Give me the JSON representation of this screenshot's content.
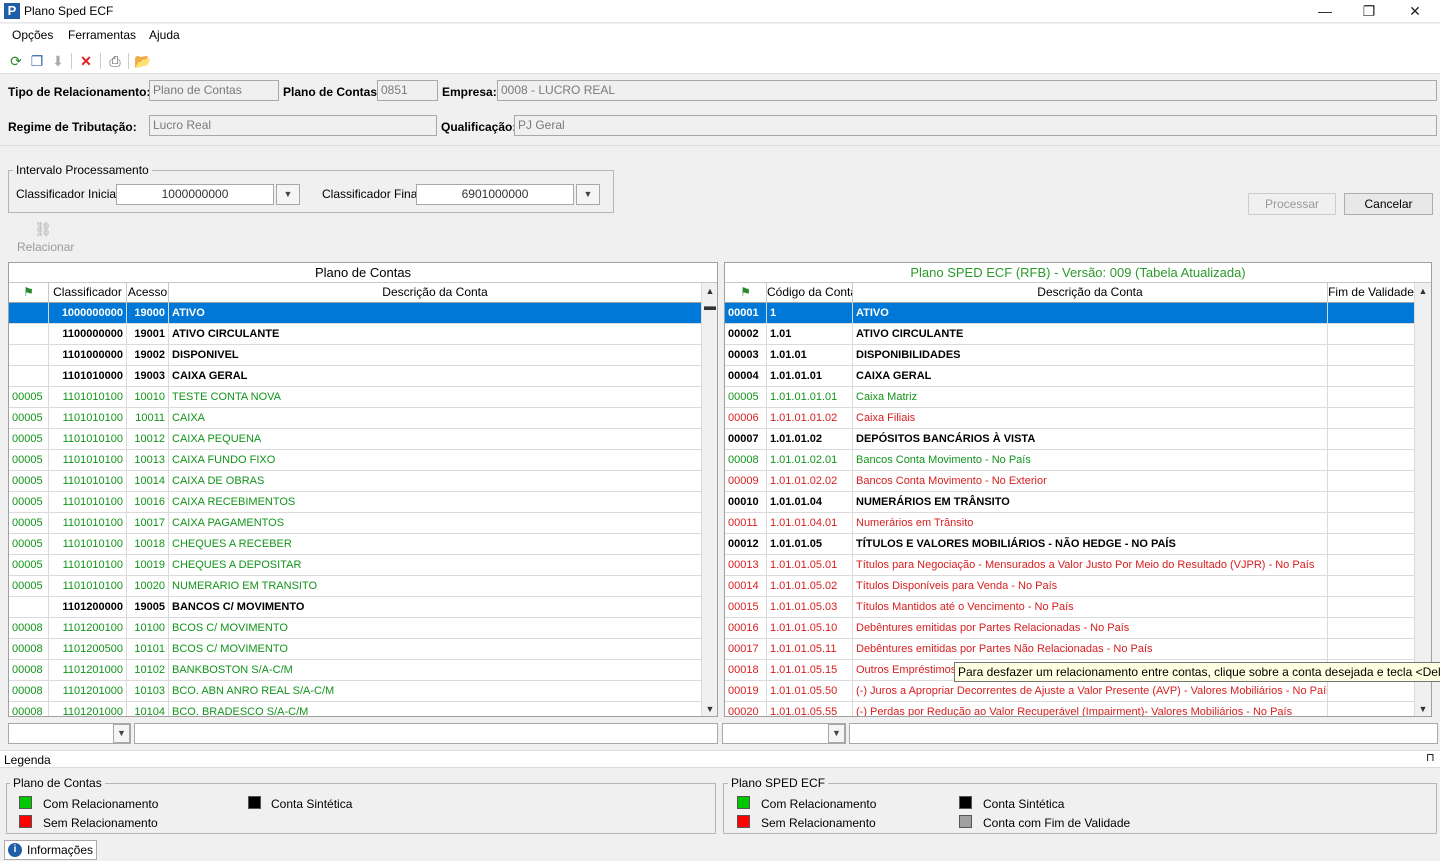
{
  "window": {
    "title": "Plano Sped ECF",
    "minimize": "—",
    "restore": "❐",
    "close": "✕"
  },
  "menu": [
    "Opções",
    "Ferramentas",
    "Ajuda"
  ],
  "header": {
    "tipo_label": "Tipo de Relacionamento:",
    "tipo_value": "Plano de Contas",
    "plano_label": "Plano de Contas:",
    "plano_value": "0851",
    "empresa_label": "Empresa:",
    "empresa_value": "0008 - LUCRO REAL",
    "regime_label": "Regime de Tributação:",
    "regime_value": "Lucro Real",
    "qualificacao_label": "Qualificação:",
    "qualificacao_value": "PJ Geral"
  },
  "intervalo": {
    "title": "Intervalo Processamento",
    "inicial_label": "Classificador Inicial:",
    "inicial_value": "1000000000",
    "final_label": "Classificador Final:",
    "final_value": "6901000000"
  },
  "buttons": {
    "processar": "Processar",
    "cancelar": "Cancelar",
    "relacionar": "Relacionar"
  },
  "left_grid": {
    "title": "Plano de Contas",
    "columns": [
      "Classificador",
      "Acesso",
      "Descrição da Conta"
    ],
    "rows": [
      {
        "t": "sel",
        "c0": "",
        "c1": "1000000000",
        "c2": "19000",
        "c3": "ATIVO"
      },
      {
        "t": "s",
        "c0": "",
        "c1": "1100000000",
        "c2": "19001",
        "c3": "ATIVO CIRCULANTE"
      },
      {
        "t": "s",
        "c0": "",
        "c1": "1101000000",
        "c2": "19002",
        "c3": "DISPONIVEL"
      },
      {
        "t": "s",
        "c0": "",
        "c1": "1101010000",
        "c2": "19003",
        "c3": "CAIXA GERAL"
      },
      {
        "t": "g",
        "c0": "00005",
        "c1": "1101010100",
        "c2": "10010",
        "c3": "TESTE CONTA NOVA"
      },
      {
        "t": "g",
        "c0": "00005",
        "c1": "1101010100",
        "c2": "10011",
        "c3": "CAIXA"
      },
      {
        "t": "g",
        "c0": "00005",
        "c1": "1101010100",
        "c2": "10012",
        "c3": "CAIXA PEQUENA"
      },
      {
        "t": "g",
        "c0": "00005",
        "c1": "1101010100",
        "c2": "10013",
        "c3": "CAIXA FUNDO FIXO"
      },
      {
        "t": "g",
        "c0": "00005",
        "c1": "1101010100",
        "c2": "10014",
        "c3": "CAIXA DE OBRAS"
      },
      {
        "t": "g",
        "c0": "00005",
        "c1": "1101010100",
        "c2": "10016",
        "c3": "CAIXA RECEBIMENTOS"
      },
      {
        "t": "g",
        "c0": "00005",
        "c1": "1101010100",
        "c2": "10017",
        "c3": "CAIXA PAGAMENTOS"
      },
      {
        "t": "g",
        "c0": "00005",
        "c1": "1101010100",
        "c2": "10018",
        "c3": "CHEQUES A RECEBER"
      },
      {
        "t": "g",
        "c0": "00005",
        "c1": "1101010100",
        "c2": "10019",
        "c3": "CHEQUES A DEPOSITAR"
      },
      {
        "t": "g",
        "c0": "00005",
        "c1": "1101010100",
        "c2": "10020",
        "c3": "NUMERARIO EM TRANSITO"
      },
      {
        "t": "s",
        "c0": "",
        "c1": "1101200000",
        "c2": "19005",
        "c3": "BANCOS C/ MOVIMENTO"
      },
      {
        "t": "g",
        "c0": "00008",
        "c1": "1101200100",
        "c2": "10100",
        "c3": "BCOS C/ MOVIMENTO"
      },
      {
        "t": "g",
        "c0": "00008",
        "c1": "1101200500",
        "c2": "10101",
        "c3": "BCOS C/ MOVIMENTO"
      },
      {
        "t": "g",
        "c0": "00008",
        "c1": "1101201000",
        "c2": "10102",
        "c3": "BANKBOSTON S/A-C/M"
      },
      {
        "t": "g",
        "c0": "00008",
        "c1": "1101201000",
        "c2": "10103",
        "c3": "BCO. ABN ANRO REAL S/A-C/M"
      },
      {
        "t": "g",
        "c0": "00008",
        "c1": "1101201000",
        "c2": "10104",
        "c3": "BCO. BRADESCO S/A-C/M"
      }
    ]
  },
  "right_grid": {
    "title": "Plano SPED ECF (RFB) - Versão: 009 (Tabela Atualizada)",
    "columns": [
      "Código da Conta",
      "Descrição da Conta",
      "Fim de Validade"
    ],
    "rows": [
      {
        "t": "sel",
        "c0": "00001",
        "c1": "1",
        "c2": "ATIVO",
        "c3": ""
      },
      {
        "t": "s",
        "c0": "00002",
        "c1": "1.01",
        "c2": "ATIVO CIRCULANTE",
        "c3": ""
      },
      {
        "t": "s",
        "c0": "00003",
        "c1": "1.01.01",
        "c2": "DISPONIBILIDADES",
        "c3": ""
      },
      {
        "t": "s",
        "c0": "00004",
        "c1": "1.01.01.01",
        "c2": "CAIXA GERAL",
        "c3": ""
      },
      {
        "t": "g",
        "c0": "00005",
        "c1": "1.01.01.01.01",
        "c2": "Caixa Matriz",
        "c3": ""
      },
      {
        "t": "r",
        "c0": "00006",
        "c1": "1.01.01.01.02",
        "c2": "Caixa Filiais",
        "c3": ""
      },
      {
        "t": "s",
        "c0": "00007",
        "c1": "1.01.01.02",
        "c2": "DEPÓSITOS BANCÁRIOS À VISTA",
        "c3": ""
      },
      {
        "t": "g",
        "c0": "00008",
        "c1": "1.01.01.02.01",
        "c2": "Bancos Conta Movimento - No País",
        "c3": ""
      },
      {
        "t": "r",
        "c0": "00009",
        "c1": "1.01.01.02.02",
        "c2": "Bancos Conta Movimento - No Exterior",
        "c3": ""
      },
      {
        "t": "s",
        "c0": "00010",
        "c1": "1.01.01.04",
        "c2": "NUMERÁRIOS EM TRÂNSITO",
        "c3": ""
      },
      {
        "t": "r",
        "c0": "00011",
        "c1": "1.01.01.04.01",
        "c2": "Numerários em Trânsito",
        "c3": ""
      },
      {
        "t": "s",
        "c0": "00012",
        "c1": "1.01.01.05",
        "c2": "TÍTULOS E VALORES MOBILIÁRIOS - NÃO HEDGE - NO PAÍS",
        "c3": ""
      },
      {
        "t": "r",
        "c0": "00013",
        "c1": "1.01.01.05.01",
        "c2": "Títulos para Negociação - Mensurados a Valor Justo Por Meio do Resultado (VJPR) - No País",
        "c3": ""
      },
      {
        "t": "r",
        "c0": "00014",
        "c1": "1.01.01.05.02",
        "c2": "Títulos Disponíveis para Venda - No País",
        "c3": ""
      },
      {
        "t": "r",
        "c0": "00015",
        "c1": "1.01.01.05.03",
        "c2": "Títulos Mantidos até o Vencimento - No País",
        "c3": ""
      },
      {
        "t": "r",
        "c0": "00016",
        "c1": "1.01.01.05.10",
        "c2": "Debêntures emitidas por Partes Relacionadas - No País",
        "c3": ""
      },
      {
        "t": "r",
        "c0": "00017",
        "c1": "1.01.01.05.11",
        "c2": "Debêntures emitidas por Partes Não Relacionadas - No País",
        "c3": ""
      },
      {
        "t": "r",
        "c0": "00018",
        "c1": "1.01.01.05.15",
        "c2": "Outros Empréstimos",
        "c3": ""
      },
      {
        "t": "r",
        "c0": "00019",
        "c1": "1.01.01.05.50",
        "c2": "(-) Juros a Apropriar Decorrentes de Ajuste a Valor Presente (AVP) -  Valores Mobiliários - No País",
        "c3": ""
      },
      {
        "t": "r",
        "c0": "00020",
        "c1": "1.01.01.05.55",
        "c2": "(-) Perdas por Redução ao Valor Recuperável (Impairment)- Valores Mobiliários - No País",
        "c3": ""
      }
    ]
  },
  "tooltip": "Para desfazer um relacionamento entre contas, clique sobre a conta desejada e tecla <Del>.",
  "legenda": {
    "title": "Legenda",
    "pin": "⊓",
    "left_title": "Plano de Contas",
    "right_title": "Plano SPED ECF",
    "com": "Com Relacionamento",
    "sem": "Sem Relacionamento",
    "sintetica": "Conta Sintética",
    "fim": "Conta com Fim de Validade",
    "colors": {
      "green": "#00c800",
      "red": "#ff0000",
      "black": "#000000",
      "gray": "#a0a0a0"
    }
  },
  "status_tab": "Informações"
}
